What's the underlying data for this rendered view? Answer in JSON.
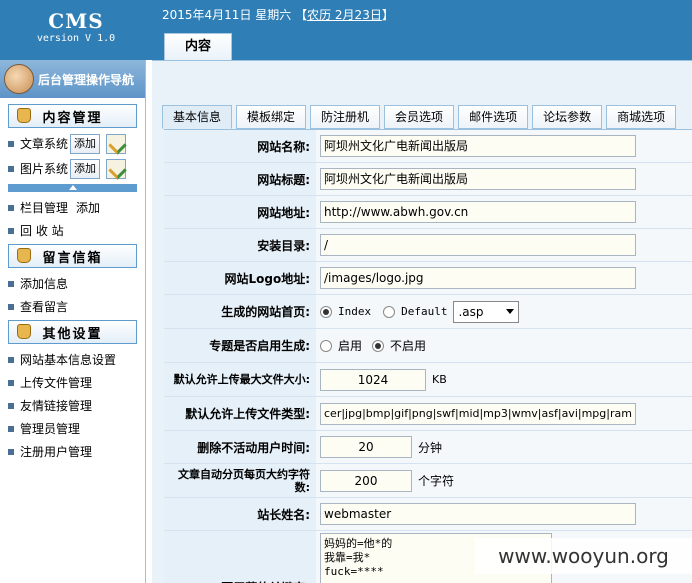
{
  "logo": {
    "title": "CMS",
    "version": "version V 1.0"
  },
  "header": {
    "date": "2015年4月11日 星期六",
    "lunar_open": "【",
    "lunar_link": "农历 2月23日",
    "lunar_close": "】",
    "top_tab": "内容"
  },
  "sidebar": {
    "heading": "后台管理操作导航",
    "sections": [
      {
        "title": "内容管理"
      },
      {
        "title": "留言信箱"
      },
      {
        "title": "其他设置"
      }
    ],
    "content_items": [
      {
        "label": "文章系统",
        "add": "添加"
      },
      {
        "label": "图片系统",
        "add": "添加"
      }
    ],
    "column_manage": "栏目管理",
    "column_add": "添加",
    "recycle": "回 收 站",
    "msg_items": [
      "添加信息",
      "查看留言"
    ],
    "other_items": [
      "网站基本信息设置",
      "上传文件管理",
      "友情链接管理",
      "管理员管理",
      "注册用户管理"
    ]
  },
  "tabs": [
    "基本信息",
    "模板绑定",
    "防注册机",
    "会员选项",
    "邮件选项",
    "论坛参数",
    "商城选项"
  ],
  "form": {
    "site_name_label": "网站名称:",
    "site_name": "阿坝州文化广电新闻出版局",
    "site_title_label": "网站标题:",
    "site_title": "阿坝州文化广电新闻出版局",
    "site_url_label": "网站地址:",
    "site_url": "http://www.abwh.gov.cn",
    "install_dir_label": "安装目录:",
    "install_dir": "/",
    "logo_label": "网站Logo地址:",
    "logo_url": "/images/logo.jpg",
    "homepage_label": "生成的网站首页:",
    "homepage_opt1": "Index",
    "homepage_opt2": "Default",
    "homepage_ext": ".asp",
    "topic_label": "专题是否启用生成:",
    "topic_opt1": "启用",
    "topic_opt2": "不启用",
    "max_size_label": "默认允许上传最大文件大小:",
    "max_size": "1024",
    "max_size_unit": "KB",
    "file_types_label": "默认允许上传文件类型:",
    "file_types": "cer|jpg|bmp|gif|png|swf|mid|mp3|wmv|asf|avi|mpg|ram",
    "inactive_label": "删除不活动用户时间:",
    "inactive": "20",
    "inactive_unit": "分钟",
    "page_chars_label": "文章自动分页每页大约字符数:",
    "page_chars": "200",
    "page_chars_unit": "个字符",
    "webmaster_label": "站长姓名:",
    "webmaster": "webmaster",
    "keywords_label": "要屏蔽的关键字:",
    "keywords": "妈妈的=他*的\n我靠=我*\nfuck=****"
  },
  "watermark": "www.wooyun.org"
}
